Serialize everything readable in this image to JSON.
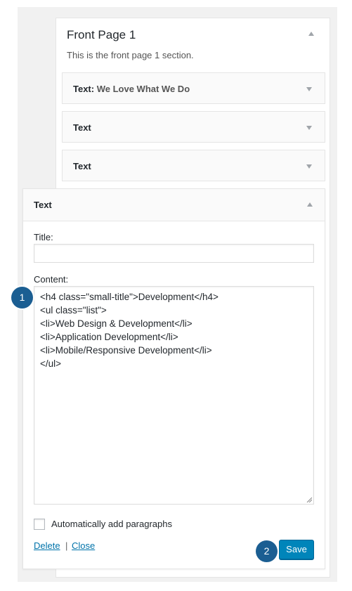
{
  "sidebar": {
    "title": "Front Page 1",
    "description": "This is the front page 1 section."
  },
  "widgets": [
    {
      "title": "Text",
      "instance": "We Love What We Do"
    },
    {
      "title": "Text",
      "instance": ""
    },
    {
      "title": "Text",
      "instance": ""
    }
  ],
  "open_widget": {
    "title": "Text",
    "title_label": "Title:",
    "title_value": "",
    "content_label": "Content:",
    "content_lines": [
      "<h4 class=\"small-title\">Development</h4>",
      "<ul class=\"list\">",
      "<li>Web Design & Development</li>",
      "<li>Application Development</li>",
      "<li>Mobile/Responsive Development</li>",
      "</ul>"
    ],
    "autop_label": "Automatically add paragraphs",
    "autop_checked": false,
    "delete_label": "Delete",
    "separator": "|",
    "close_label": "Close",
    "save_label": "Save"
  },
  "badges": [
    "1",
    "2"
  ],
  "colors": {
    "accent": "#0085ba",
    "link": "#0073aa",
    "badge": "#1b5e92"
  }
}
